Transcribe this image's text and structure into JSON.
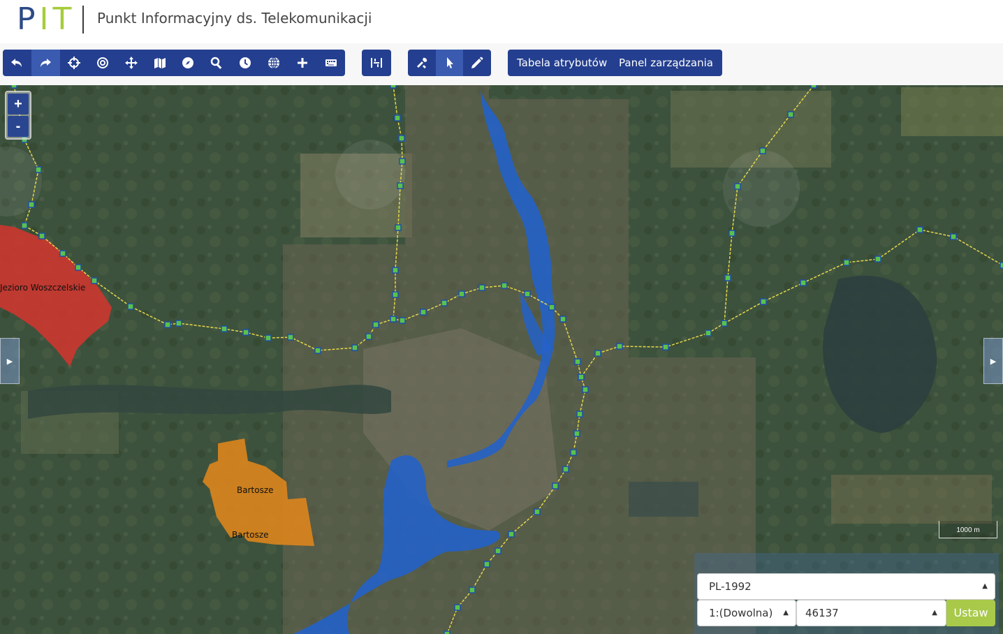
{
  "header": {
    "logo_p": "P",
    "logo_it": "IT",
    "title": "Punkt Informacyjny ds. Telekomunikacji"
  },
  "toolbar": {
    "nav_tools": [
      {
        "name": "undo-icon",
        "active": false
      },
      {
        "name": "redo-icon",
        "active": true
      },
      {
        "name": "crosshair-icon",
        "active": false
      },
      {
        "name": "target-icon",
        "active": false
      },
      {
        "name": "move-icon",
        "active": false
      },
      {
        "name": "map-icon",
        "active": false
      },
      {
        "name": "compass-icon",
        "active": false
      },
      {
        "name": "search-icon",
        "active": false
      },
      {
        "name": "clock-icon",
        "active": false
      },
      {
        "name": "globe-icon",
        "active": false
      },
      {
        "name": "plus-icon",
        "active": false
      },
      {
        "name": "keyboard-icon",
        "active": false
      }
    ],
    "measure_tool": "ruler-icon",
    "edit_tools": [
      {
        "name": "tools-icon",
        "active": false
      },
      {
        "name": "pointer-icon",
        "active": true
      },
      {
        "name": "pencil-icon",
        "active": false
      }
    ],
    "attributes_label": "Tabela atrybutów",
    "management_label": "Panel zarządzania"
  },
  "map": {
    "zoom_in": "+",
    "zoom_out": "-",
    "labels": {
      "lake": "Jezioro Woszczelskie",
      "area1": "Bartosze",
      "area2": "Bartosze"
    },
    "scale_label": "1000 m",
    "colors": {
      "lake_polygon": "#d0352f",
      "area_polygon": "#e0861b",
      "flood_polygon": "#2462c8",
      "network_line": "#e6d84a",
      "node": "#5ac24b"
    }
  },
  "controls": {
    "crs": "PL-1992",
    "scale_select": "1:(Dowolna)",
    "scale_value": "46137",
    "set_button": "Ustaw"
  }
}
